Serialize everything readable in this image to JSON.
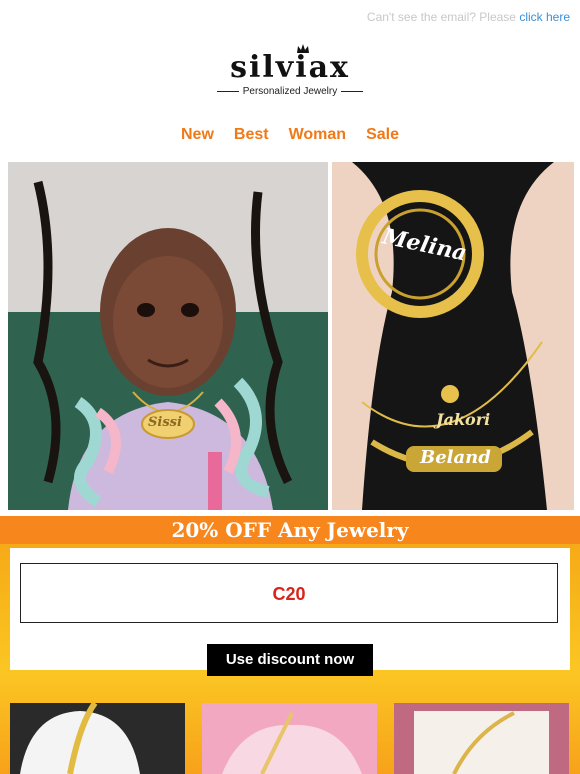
{
  "topbar": {
    "prefix": "Can't see the email? Please",
    "link_label": "click here"
  },
  "logo": {
    "wordmark": "silviax",
    "tagline": "Personalized Jewelry"
  },
  "nav": [
    {
      "label": "New"
    },
    {
      "label": "Best"
    },
    {
      "label": "Woman"
    },
    {
      "label": "Sale"
    }
  ],
  "hero": {
    "right": {
      "earring_text": "Melina",
      "pendant_text": "Jakori",
      "nameplate_text": "Beland"
    },
    "left": {
      "necklace_text": "Sissi"
    }
  },
  "promo": {
    "banner": "20% OFF Any Jewelry",
    "code": "C20",
    "cta_label": "Use discount now"
  },
  "colors": {
    "nav": "#f07a17",
    "code": "#d9241c",
    "link": "#3a8ed8",
    "promo_band": "#f7861c"
  }
}
